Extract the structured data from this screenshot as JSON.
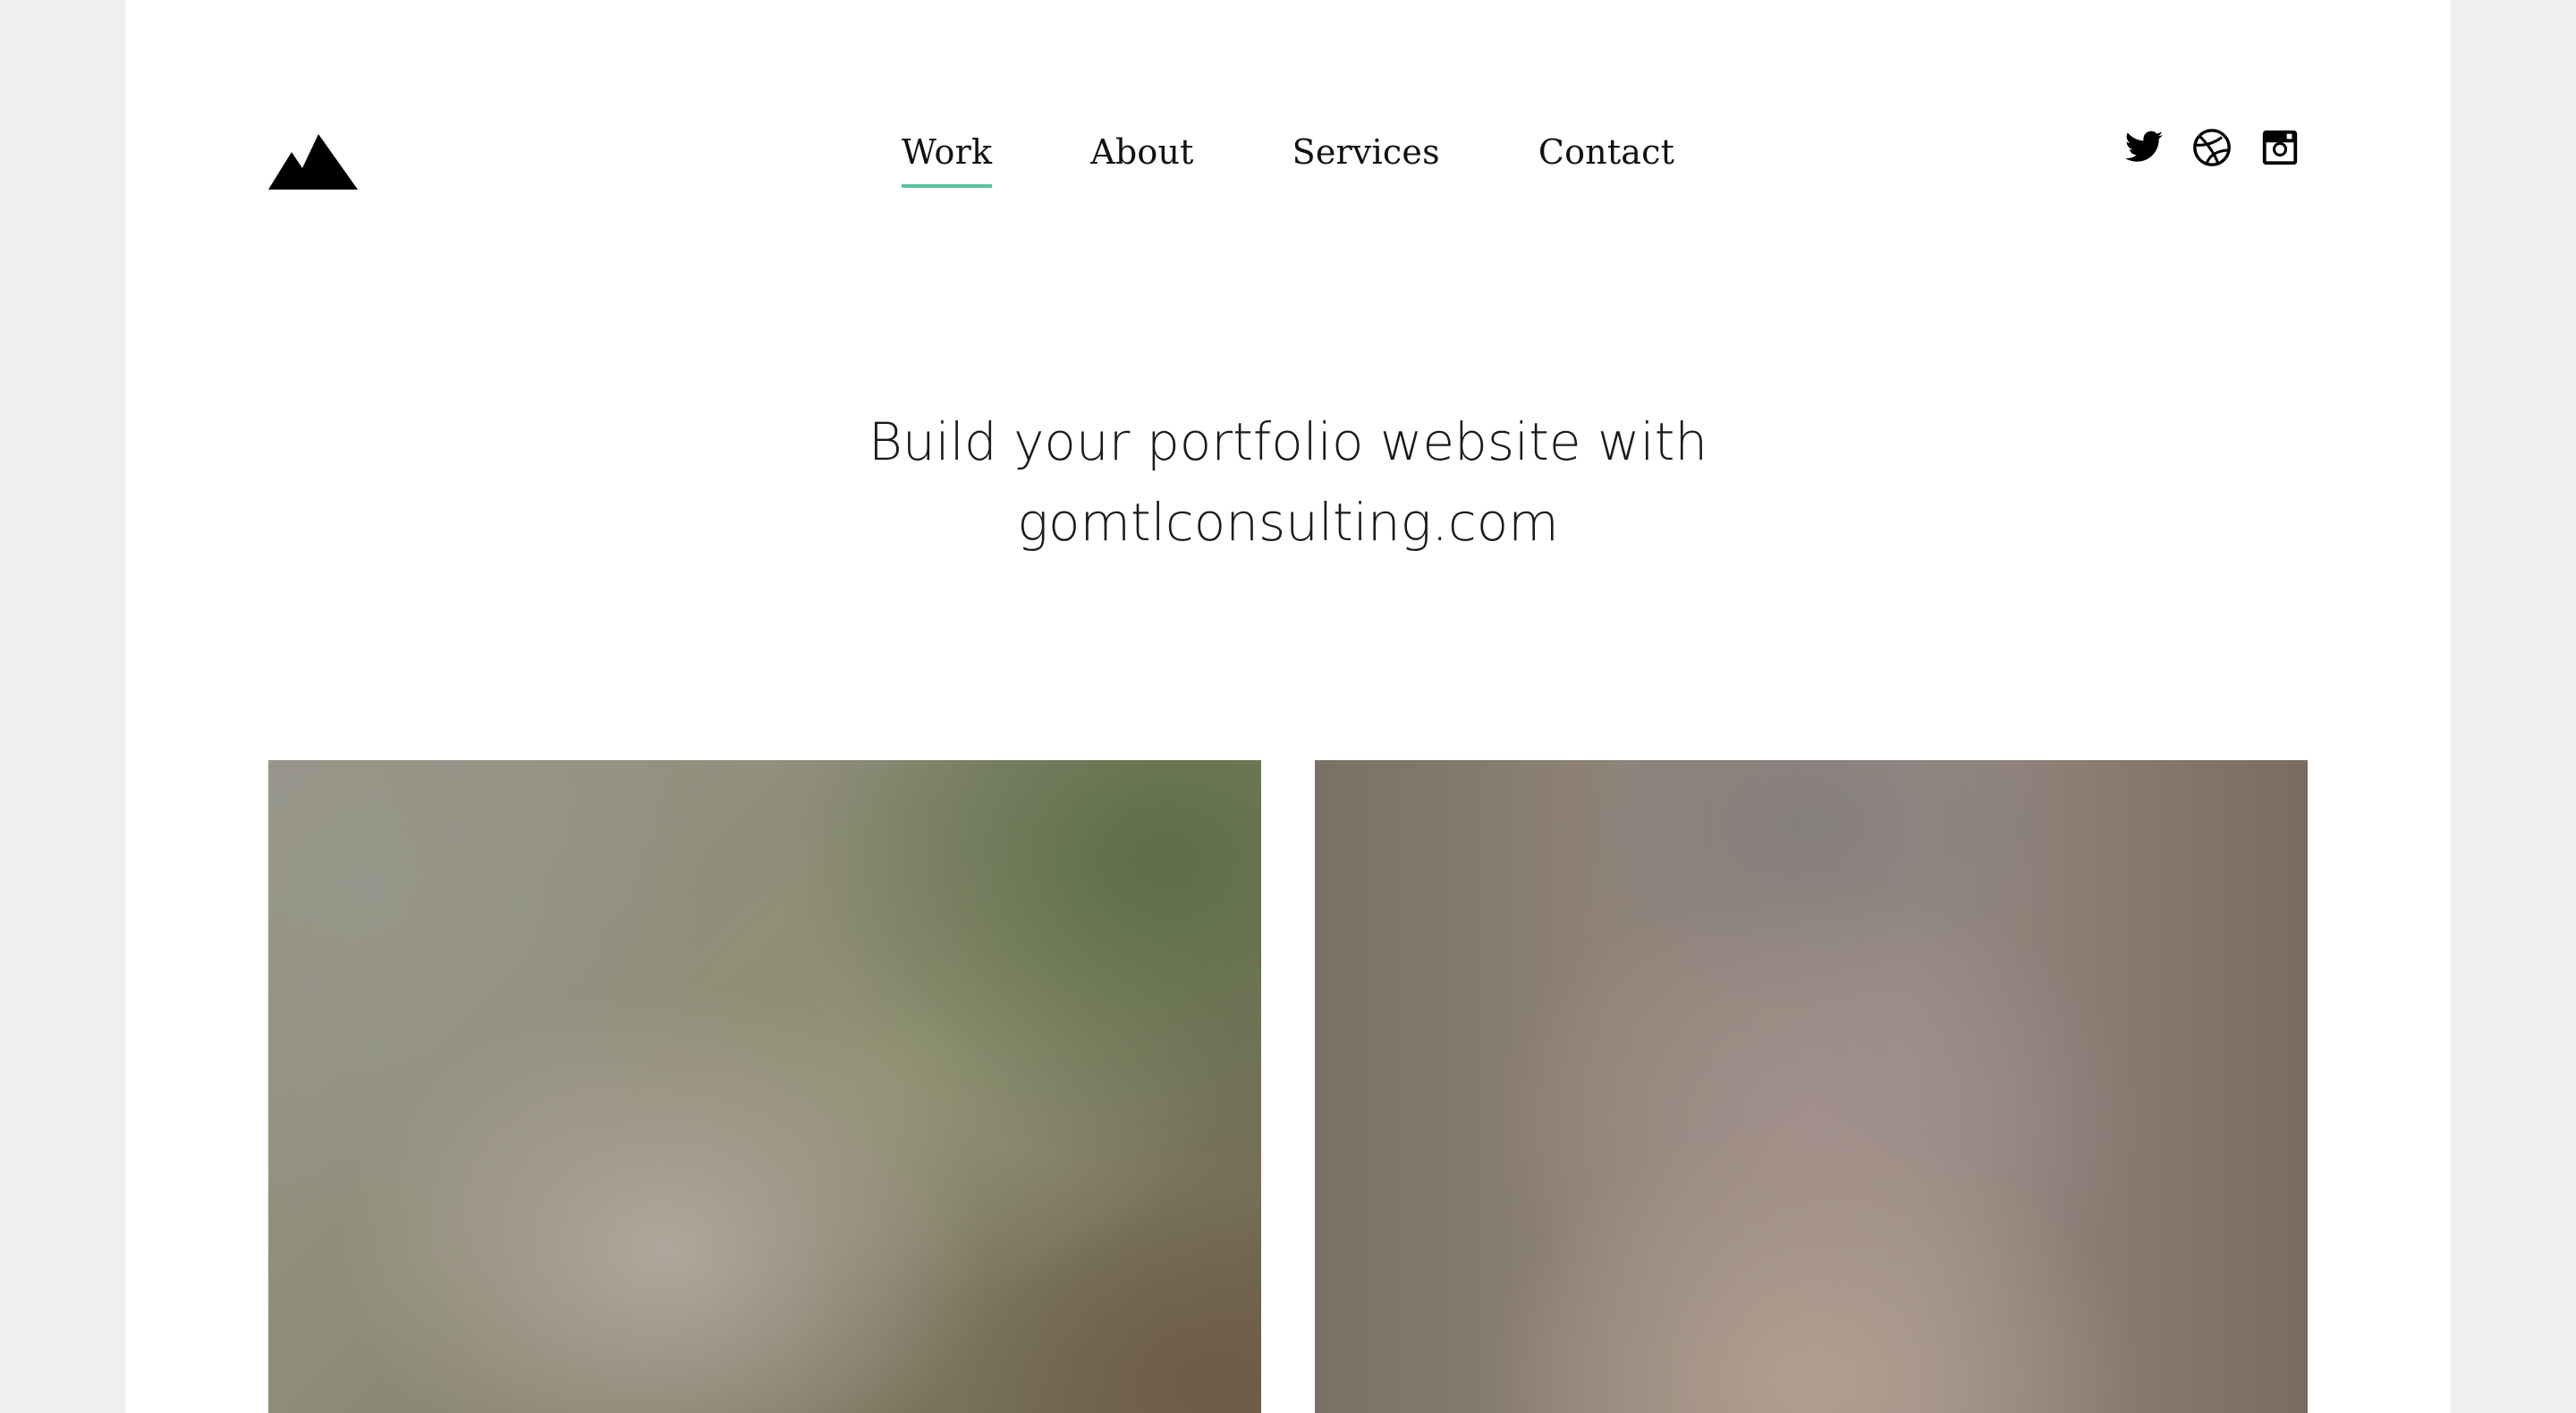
{
  "header": {
    "logo_icon": "mountain-logo-icon",
    "nav": [
      {
        "label": "Work",
        "active": true
      },
      {
        "label": "About",
        "active": false
      },
      {
        "label": "Services",
        "active": false
      },
      {
        "label": "Contact",
        "active": false
      }
    ],
    "social_icons": [
      "twitter-icon",
      "dribbble-icon",
      "instagram-icon"
    ]
  },
  "hero": {
    "line1": "Build your portfolio website with",
    "line2": "gomtlconsulting.com"
  },
  "colors": {
    "accent": "#59c2a0",
    "text": "#111111",
    "outer_background": "#eef0f2",
    "page_background": "#ffffff"
  },
  "gallery": {
    "cards": [
      "portfolio-image-1",
      "portfolio-image-2"
    ]
  }
}
